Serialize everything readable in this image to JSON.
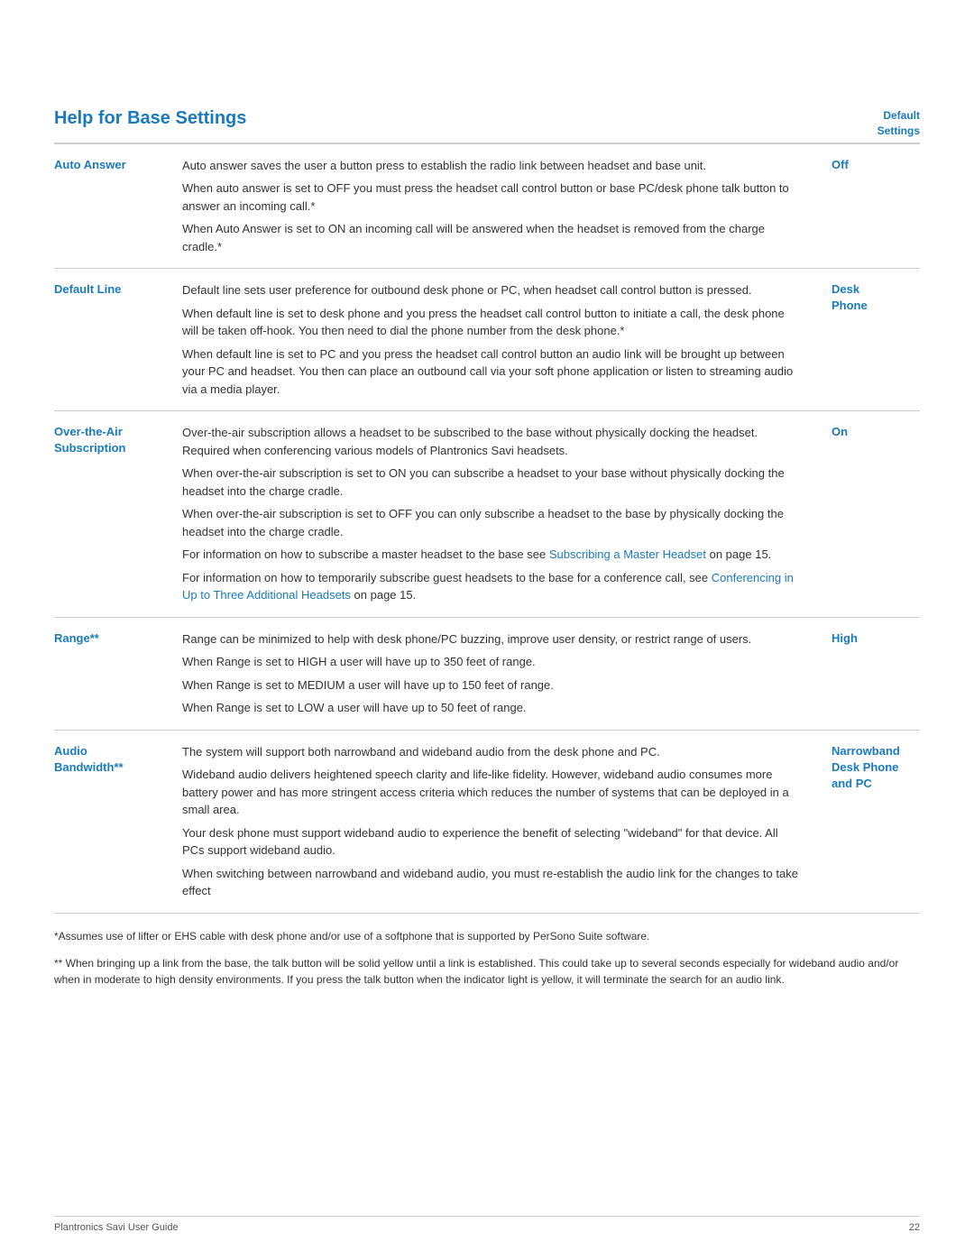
{
  "page": {
    "title": "Help for Base Settings",
    "default_settings_header": "Default\nSettings",
    "footer_brand": "Plantronics Savi User Guide",
    "footer_page": "22"
  },
  "settings": [
    {
      "label": "Auto Answer",
      "default": "Off",
      "paragraphs": [
        "Auto answer saves the user a button press to establish the radio link between headset and base unit.",
        "When auto answer is set to OFF you must press the headset call control button or base PC/desk phone talk button to answer an incoming call.*",
        "When Auto Answer is set to ON an incoming call will be answered when the headset is removed from the charge cradle.*"
      ]
    },
    {
      "label": "Default Line",
      "default": "Desk\nPhone",
      "paragraphs": [
        "Default line sets user preference for outbound desk phone or PC, when headset call control button is pressed.",
        "When default line is set to desk phone and you press the headset call control button to initiate a call, the desk phone will be taken off-hook. You then need to dial the phone number from the desk phone.*",
        "When default line is set to PC and you press the headset call control button an audio link will be brought up between your PC and headset. You then can place an outbound call via your soft phone application or listen to streaming audio via a media player."
      ]
    },
    {
      "label": "Over-the-Air\nSubscription",
      "default": "On",
      "paragraphs": [
        "Over-the-air subscription allows a headset to be subscribed to the base without physically docking the headset. Required when conferencing various models of Plantronics Savi headsets.",
        "When over-the-air subscription is set to ON you can subscribe a headset to your base without physically docking the headset into the charge cradle.",
        "When over-the-air subscription is set to OFF you can only subscribe a headset to the base by physically docking the headset into the charge cradle.",
        "For information on how to subscribe a master headset to the base see Subscribing a Master Headset on page 15.",
        "For information on how to temporarily subscribe guest headsets to the base for a conference call, see Conferencing in Up to Three Additional Headsets on page 15."
      ],
      "para_links": [
        {
          "index": 3,
          "link_text": "Subscribing a Master Headset",
          "before": "For information on how to subscribe a master headset to the base see ",
          "after": " on page 15."
        },
        {
          "index": 4,
          "link_text": "Conferencing in Up to Three Additional Headsets",
          "before": "For information on how to temporarily subscribe guest headsets to the base for a conference call, see ",
          "after": " on page 15."
        }
      ]
    },
    {
      "label": "Range**",
      "default": "High",
      "paragraphs": [
        "Range can be minimized to help with desk phone/PC buzzing, improve user density, or restrict range of users.",
        "When Range is set to HIGH a user will have up to 350 feet of range.",
        "When Range is set to MEDIUM a user will have up to 150 feet of range.",
        "When Range is set to LOW a user will have up to 50 feet of range."
      ]
    },
    {
      "label": "Audio\nBandwidth**",
      "default": "Narrowband\nDesk Phone\nand PC",
      "paragraphs": [
        "The system will support both narrowband and wideband audio from the desk phone and PC.",
        "Wideband audio delivers heightened speech clarity and life-like fidelity. However, wideband audio consumes more battery power and has more stringent access criteria which reduces the number of systems that can be deployed in a small area.",
        "Your desk phone must support wideband audio to experience the benefit of selecting \"wideband\" for that device. All PCs support wideband audio.",
        "When switching between narrowband and wideband audio, you must re-establish the audio link for the changes to take effect"
      ]
    }
  ],
  "footnotes": [
    "*Assumes use of lifter or EHS cable with desk phone and/or use of a softphone that is supported by PerSono Suite software.",
    "** When bringing up a link from the base, the talk button will be solid yellow until a link is established. This could take up to several seconds especially for wideband audio and/or when in moderate to high density environments. If you press the talk button when the indicator light is yellow, it will terminate the search for an audio link."
  ]
}
